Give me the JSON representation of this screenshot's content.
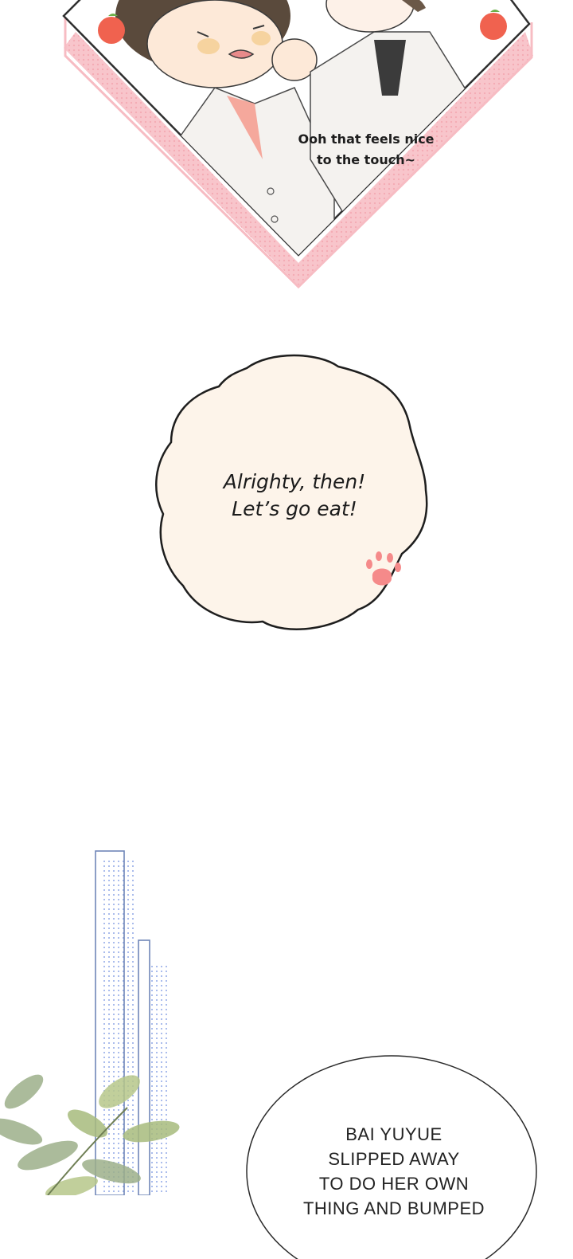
{
  "panel_top": {
    "caption": "Ooh that feels nice\nto the touch~",
    "colors": {
      "frame_pink": "#f7c8cc",
      "frame_border": "#3a3a3a",
      "apple": "#f0624f"
    }
  },
  "cloud_bubble": {
    "text": "Alrighty, then!\nLet’s go eat!",
    "colors": {
      "fill": "#fdf4ea",
      "paw": "#f58a8a"
    }
  },
  "narration_box": {
    "text": "BAI YUYUE\nSLIPPED AWAY\nTO DO HER OWN\nTHING AND BUMPED"
  }
}
